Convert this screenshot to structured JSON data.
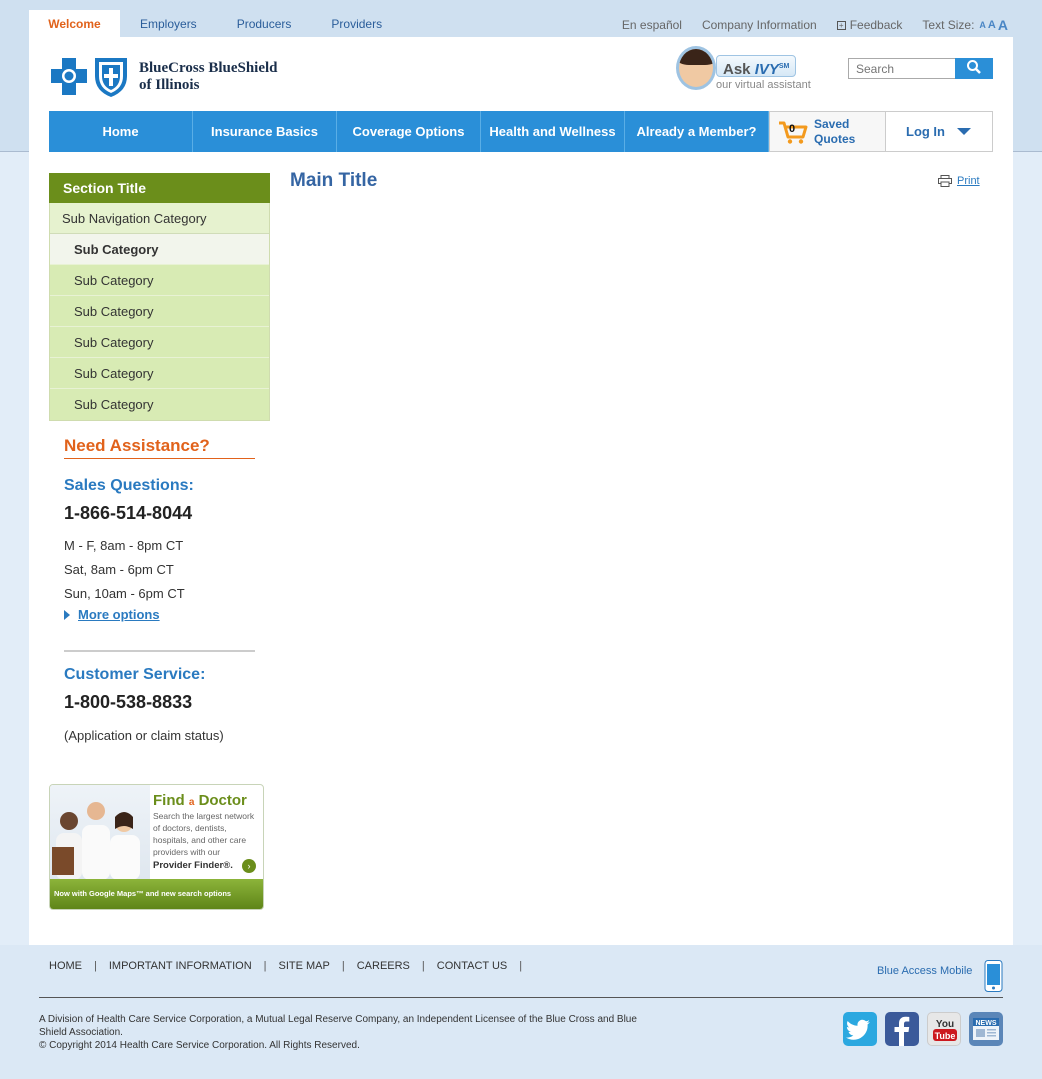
{
  "top_tabs": [
    "Welcome",
    "Employers",
    "Producers",
    "Providers"
  ],
  "utility": {
    "espanol": "En español",
    "company": "Company Information",
    "feedback": "Feedback",
    "text_size": "Text Size:"
  },
  "logo": {
    "line1": "BlueCross BlueShield",
    "line2": "of Illinois"
  },
  "ivy": {
    "ask": "Ask",
    "name": "IVY",
    "mark": "SM",
    "sub": "our virtual assistant"
  },
  "search": {
    "placeholder": "Search"
  },
  "nav": {
    "items": [
      "Home",
      "Insurance Basics",
      "Coverage Options",
      "Health and Wellness",
      "Already a Member?"
    ],
    "quotes_count": "0",
    "quotes_label": "Saved Quotes",
    "login": "Log In"
  },
  "sidebar": {
    "section_title": "Section Title",
    "sub_heading": "Sub Navigation Category",
    "items": [
      "Sub Category",
      "Sub Category",
      "Sub Category",
      "Sub Category",
      "Sub Category",
      "Sub Category"
    ]
  },
  "assistance": {
    "title": "Need Assistance?",
    "sales_title": "Sales Questions:",
    "sales_phone": "1-866-514-8044",
    "hours": [
      "M - F, 8am - 8pm CT",
      "Sat, 8am - 6pm CT",
      "Sun, 10am - 6pm CT"
    ],
    "more": "More options",
    "cs_title": "Customer Service:",
    "cs_phone": "1-800-538-8833",
    "cs_note": "(Application or claim status)"
  },
  "find_doctor": {
    "title_find": "Find",
    "title_a": "a",
    "title_doctor": "Doctor",
    "body": "Search the largest network of doctors, dentists, hospitals, and other care providers with our",
    "cta": "Provider Finder®.",
    "bar": "Now with Google Maps™ and new search options"
  },
  "main": {
    "title": "Main Title",
    "print": "Print"
  },
  "footer": {
    "links": [
      "HOME",
      "IMPORTANT INFORMATION",
      "SITE MAP",
      "CAREERS",
      "CONTACT US"
    ],
    "mobile": "Blue Access Mobile",
    "legal": "A Division of Health Care Service Corporation, a Mutual Legal Reserve Company, an Independent Licensee of the Blue Cross and Blue Shield Association.",
    "copyright": "© Copyright 2014 Health Care Service Corporation. All Rights Reserved."
  },
  "colors": {
    "nav_blue": "#2a8fd8",
    "accent_orange": "#e1621b",
    "green": "#6b8e1b"
  }
}
